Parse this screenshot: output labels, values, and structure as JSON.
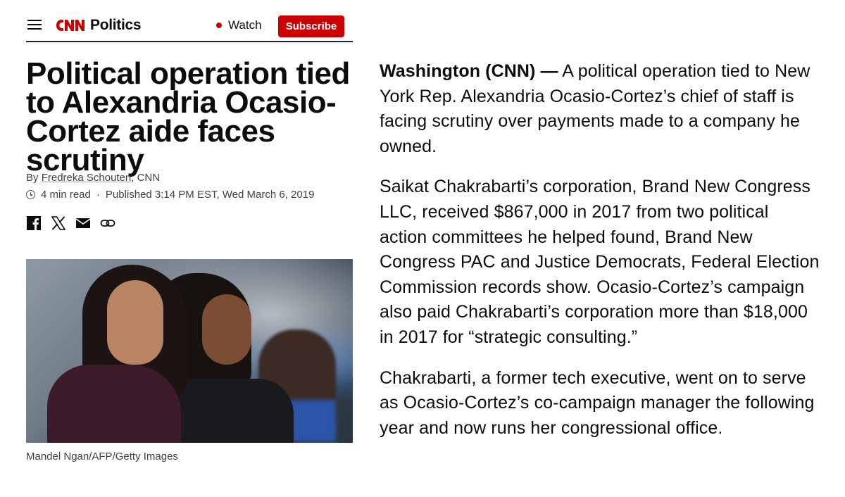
{
  "header": {
    "section": "Politics",
    "watch_label": "Watch",
    "subscribe_label": "Subscribe"
  },
  "article": {
    "headline": "Political operation tied to Alexandria Ocasio-Cortez aide faces scrutiny",
    "byline_prefix": "By",
    "author": "Fredreka Schouten",
    "outlet": ", CNN",
    "read_time": "4 min read",
    "separator": "·",
    "published": "Published 3:14 PM EST, Wed March 6, 2019",
    "photo_credit": "Mandel Ngan/AFP/Getty Images",
    "dateline": "Washington (CNN) —",
    "paragraph1_rest": " A political operation tied to New York Rep. Alexandria Ocasio-Cortez’s chief of staff is facing scrutiny over payments made to a company he owned.",
    "paragraph2": "Saikat Chakrabarti’s corporation, Brand New Congress LLC, received $867,000 in 2017 from two political action committees he helped found, Brand New Congress PAC and Justice Democrats, Federal Election Commission records show. Ocasio-Cortez’s campaign also paid Chakrabarti’s corporation more than $18,000 in 2017 for “strategic consulting.”",
    "paragraph3": "Chakrabarti, a former tech executive, went on to serve as Ocasio-Cortez’s co-campaign manager the following year and now runs her congressional office."
  },
  "share_icons": [
    "facebook-icon",
    "x-icon",
    "email-icon",
    "link-icon"
  ],
  "colors": {
    "brand_red": "#cc0000",
    "text": "#0c0c0c",
    "meta_text": "#404040"
  }
}
